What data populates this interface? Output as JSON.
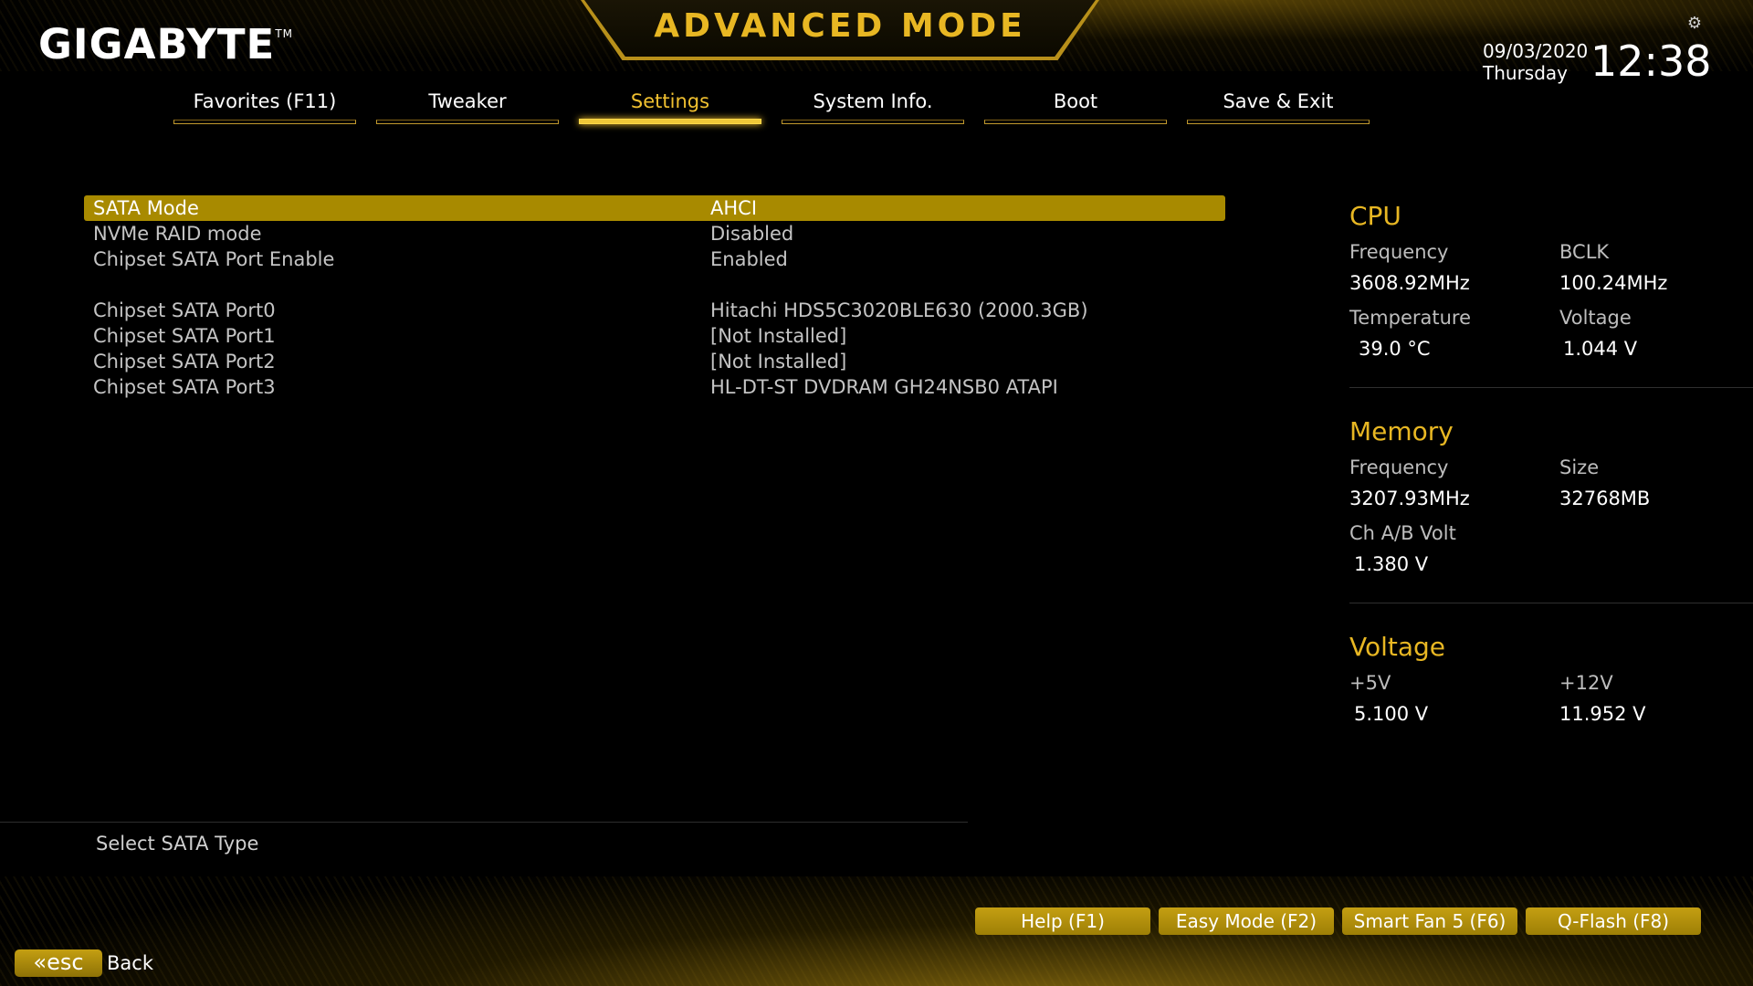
{
  "header": {
    "brand": "GIGABYTE",
    "brand_tm": "TM",
    "mode_title": "ADVANCED MODE",
    "date": "09/03/2020",
    "day": "Thursday",
    "time": "12:38",
    "settings_icon": "gear-icon"
  },
  "tabs": [
    {
      "label": "Favorites (F11)"
    },
    {
      "label": "Tweaker"
    },
    {
      "label": "Settings",
      "active": true
    },
    {
      "label": "System Info."
    },
    {
      "label": "Boot"
    },
    {
      "label": "Save & Exit"
    }
  ],
  "settings": [
    {
      "label": "SATA Mode",
      "value": "AHCI",
      "selected": true
    },
    {
      "label": "NVMe RAID mode",
      "value": "Disabled"
    },
    {
      "label": "Chipset SATA Port Enable",
      "value": "Enabled"
    },
    {
      "label": "Chipset SATA Port0",
      "value": "Hitachi HDS5C3020BLE630 (2000.3GB)"
    },
    {
      "label": "Chipset SATA Port1",
      "value": "[Not Installed]"
    },
    {
      "label": "Chipset SATA Port2",
      "value": "[Not Installed]"
    },
    {
      "label": "Chipset SATA Port3",
      "value": "HL-DT-ST DVDRAM GH24NSB0 ATAPI"
    }
  ],
  "help_text": "Select SATA Type",
  "monitor": {
    "cpu": {
      "title": "CPU",
      "frequency_label": "Frequency",
      "frequency": "3608.92MHz",
      "bclk_label": "BCLK",
      "bclk": "100.24MHz",
      "temperature_label": "Temperature",
      "temperature": "39.0 °C",
      "voltage_label": "Voltage",
      "voltage": "1.044 V"
    },
    "memory": {
      "title": "Memory",
      "frequency_label": "Frequency",
      "frequency": "3207.93MHz",
      "size_label": "Size",
      "size": "32768MB",
      "chab_volt_label": "Ch A/B Volt",
      "chab_volt": "1.380 V"
    },
    "voltage": {
      "title": "Voltage",
      "v5_label": "+5V",
      "v5": "5.100 V",
      "v12_label": "+12V",
      "v12": "11.952 V"
    }
  },
  "footer": {
    "buttons": [
      {
        "label": "Help (F1)"
      },
      {
        "label": "Easy Mode (F2)"
      },
      {
        "label": "Smart Fan 5 (F6)"
      },
      {
        "label": "Q-Flash (F8)"
      }
    ],
    "esc_label": "esc",
    "back_label": "Back"
  },
  "colors": {
    "accent": "#e8b723",
    "selected_row": "#a88a00",
    "button": "#b08f0c"
  }
}
